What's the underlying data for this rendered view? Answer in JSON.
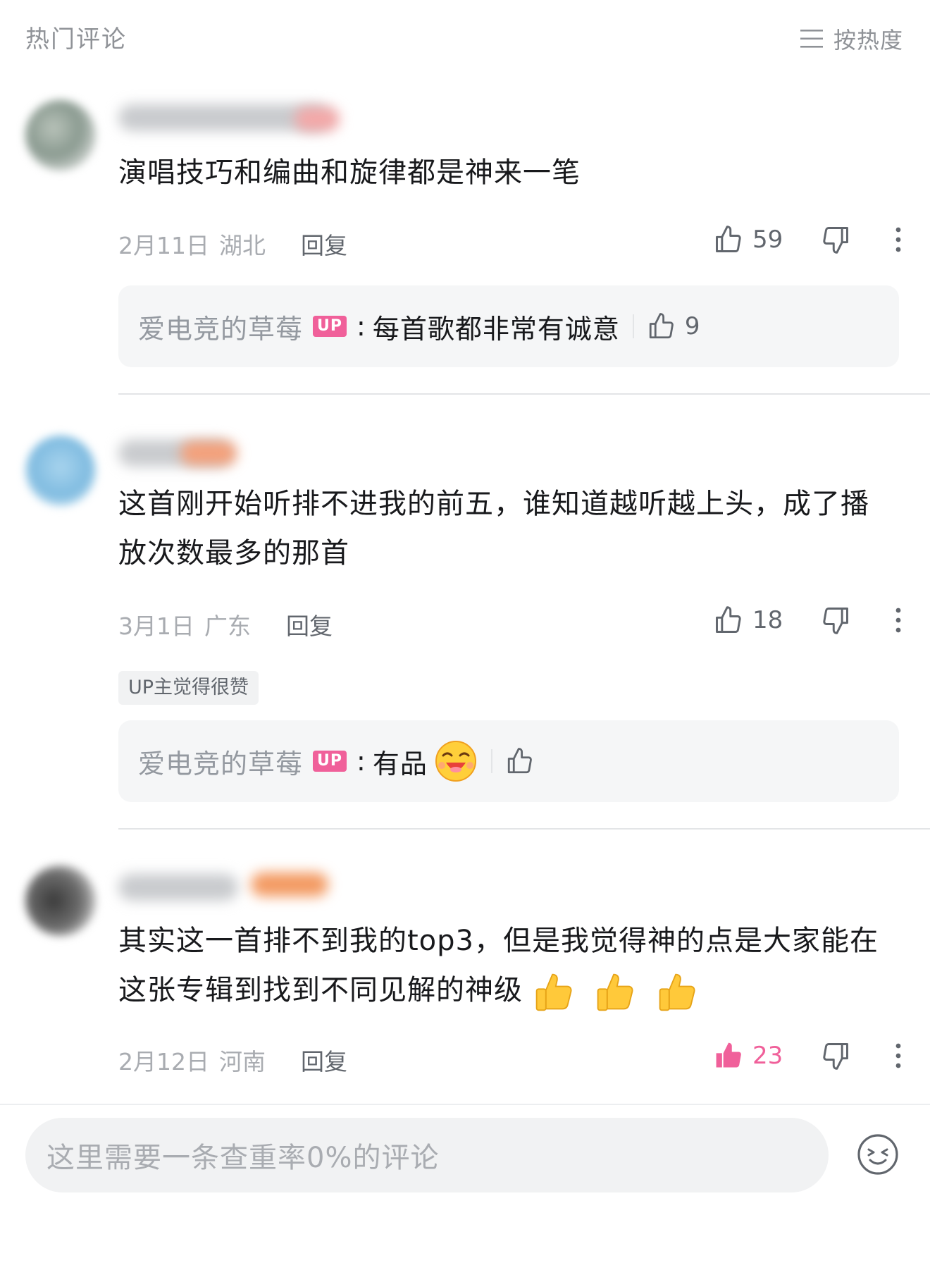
{
  "header": {
    "title": "热门评论",
    "sort_label": "按热度"
  },
  "comments": [
    {
      "content": "演唱技巧和编曲和旋律都是神来一笔",
      "date": "2月11日",
      "location": "湖北",
      "reply_label": "回复",
      "likes": "59",
      "liked": false,
      "up_reply": {
        "name": "爱电竞的草莓",
        "badge": "UP",
        "text": "每首歌都非常有诚意",
        "likes": "9"
      }
    },
    {
      "content": "这首刚开始听排不进我的前五，谁知道越听越上头，成了播放次数最多的那首",
      "date": "3月1日",
      "location": "广东",
      "reply_label": "回复",
      "likes": "18",
      "liked": false,
      "up_note": "UP主觉得很赞",
      "up_reply": {
        "name": "爱电竞的草莓",
        "badge": "UP",
        "text": "有品",
        "likes": ""
      }
    },
    {
      "content": "其实这一首排不到我的top3，但是我觉得神的点是大家能在这张专辑到找到不同见解的神级",
      "date": "2月12日",
      "location": "河南",
      "reply_label": "回复",
      "likes": "23",
      "liked": true
    }
  ],
  "composer": {
    "placeholder": "这里需要一条查重率0%的评论"
  },
  "colors": {
    "accent_pink": "#f0609a",
    "text_gray": "#61666d",
    "muted_gray": "#a9acb1"
  }
}
